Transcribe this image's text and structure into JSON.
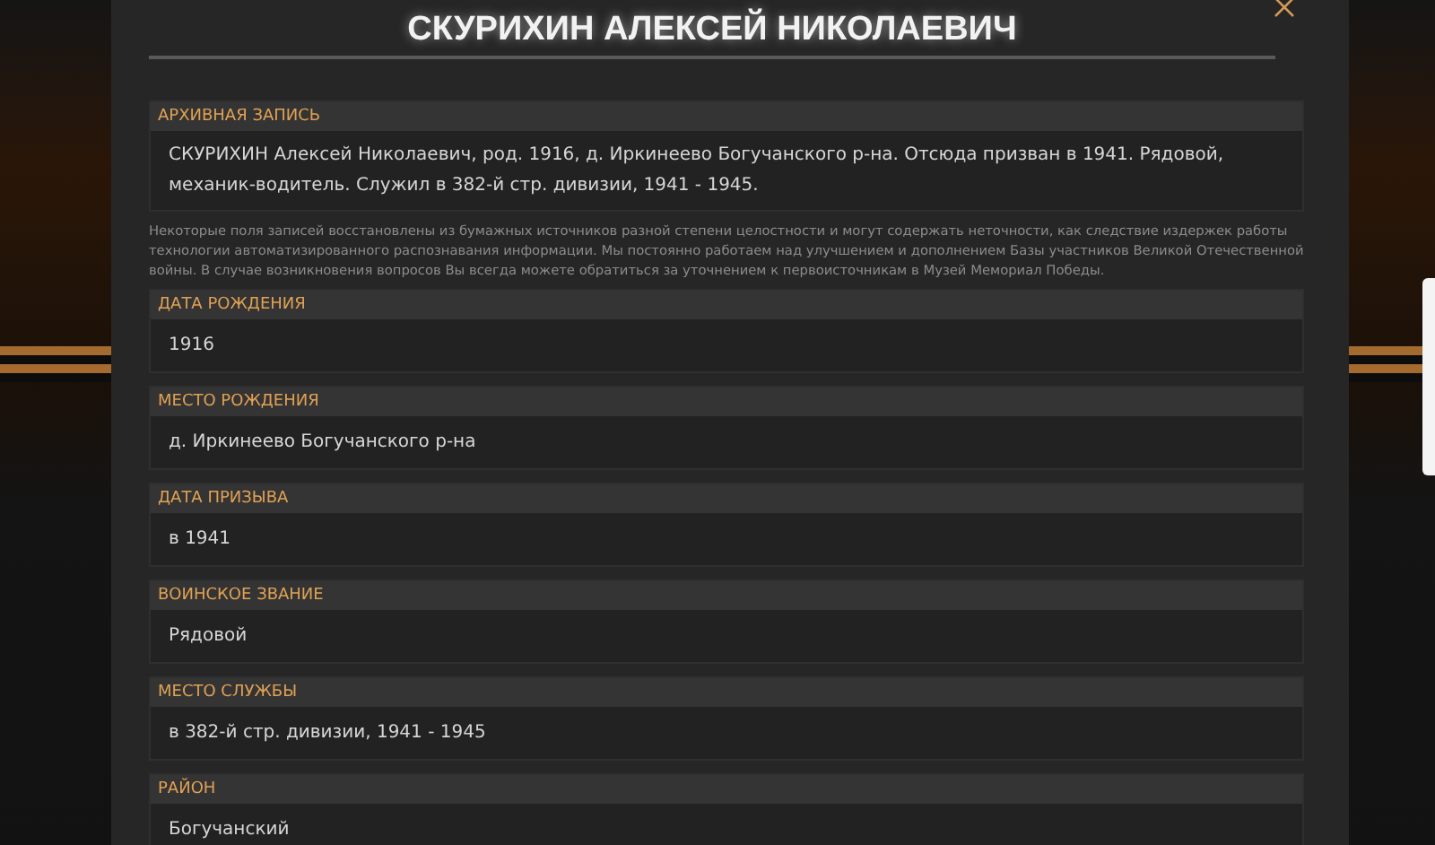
{
  "title": "СКУРИХИН АЛЕКСЕЙ НИКОЛАЕВИЧ",
  "archive": {
    "heading": "АРХИВНАЯ ЗАПИСЬ",
    "value": "СКУРИХИН Алексей Николаевич, род. 1916, д. Иркинеево Богучанского р-на. Отсюда призван в 1941. Рядовой, механик-водитель. Служил в 382-й стр. дивизии, 1941 - 1945."
  },
  "note": "Некоторые поля записей восстановлены из бумажных источников разной степени целостности и могут содержать неточности, как следствие издержек работы технологии автоматизированного распознавания информации. Мы постоянно работаем над улучшением и дополнением Базы участников Великой Отечественной войны. В случае возникновения вопросов Вы всегда можете обратиться за уточнением к первоисточникам в Музей Мемориал Победы.",
  "fields": [
    {
      "heading": "ДАТА РОЖДЕНИЯ",
      "value": "1916"
    },
    {
      "heading": "МЕСТО РОЖДЕНИЯ",
      "value": "д. Иркинеево Богучанского р-на"
    },
    {
      "heading": "ДАТА ПРИЗЫВА",
      "value": "в 1941"
    },
    {
      "heading": "ВОИНСКОЕ ЗВАНИЕ",
      "value": "Рядовой"
    },
    {
      "heading": "МЕСТО СЛУЖБЫ",
      "value": "в 382-й стр. дивизии, 1941 - 1945"
    },
    {
      "heading": "РАЙОН",
      "value": "Богучанский"
    }
  ]
}
